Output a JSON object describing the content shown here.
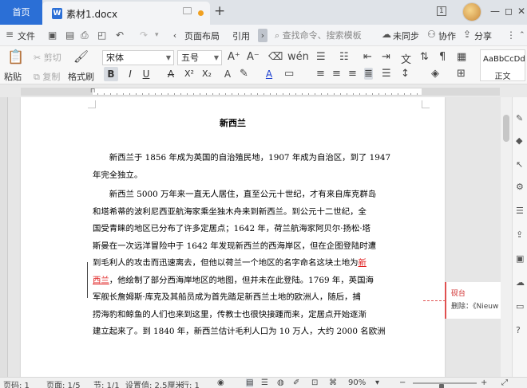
{
  "tabbar": {
    "home_label": "首页",
    "doc_icon": "W",
    "doc_title": "素材1.docx",
    "new_tab_symbol": "+",
    "window_controls": [
      "1",
      "—",
      "◻",
      "✕"
    ]
  },
  "menubar": {
    "file_label": "文件",
    "icons": [
      "save-icon",
      "print-icon",
      "print-preview-icon",
      "export-icon",
      "undo-icon",
      "redo-icon"
    ],
    "layout_tab": "页面布局",
    "reference_tab": "引用",
    "search_placeholder": "查找命令、搜索模板",
    "sync_label": "未同步",
    "collab_label": "协作",
    "share_label": "分享"
  },
  "ribbon": {
    "paste_label": "粘贴",
    "cut_label": "剪切",
    "copy_label": "复制",
    "format_painter_label": "格式刷",
    "font_name": "宋体",
    "font_size": "五号",
    "format_buttons": [
      "B",
      "I",
      "U",
      "A",
      "X²",
      "X₂",
      "A",
      "A"
    ],
    "style_sample": "AaBbCcDd",
    "style_name": "正文"
  },
  "document": {
    "heading": "新西兰",
    "para1": [
      "新西兰于 1856 年成为英国的自治殖民地，1907 年成为自治区，到了 1947",
      "年完全独立。"
    ],
    "para2": [
      "新西兰 5000 万年来一直无人居住，直至公元十世纪，才有来自库克群岛",
      "和塔希蒂的波利尼西亚航海家乘坐独木舟来到新西兰。到公元十二世纪，全",
      "国受青睐的地区已分布了许多定居点；1642 年，荷兰航海家阿贝尔·扬松·塔",
      "斯曼在一次远洋冒险中于 1642 年发现新西兰的西海岸区，但在企图登陆时遭",
      "到毛利人的攻击而迅速离去，但他以荷兰一个地区的名字命名这块土地为",
      "，他绘制了部分西海岸地区的地图，但并未在此登陆。1769 年，英国海",
      "军舰长詹姆斯·库克及其船员成为首先踏足新西兰土地的欧洲人，随后，捕",
      "捞海豹和鲸鱼的人们也来到这里，传教士也很快接踵而来，定居点开始逐渐",
      "建立起来了。到 1840 年，新西兰估计毛利人口为 10 万人，大约 2000 名欧洲"
    ],
    "inserted_text_1": "新",
    "inserted_text_2": "西兰"
  },
  "comment": {
    "author": "砚台",
    "text": "删除：《Nieuw Ze"
  },
  "statusbar": {
    "page_code": "页码: 1",
    "page_of": "页面: 1/5",
    "section": "节: 1/1",
    "setting": "设置值: 2.5厘米",
    "row": "行: 1",
    "zoom": "90%",
    "zoom_level": 0.9
  }
}
